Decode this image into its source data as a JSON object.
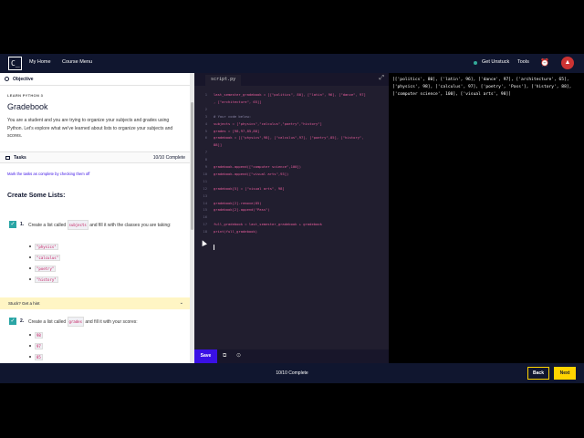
{
  "nav": {
    "logo": "C_",
    "my_home": "My Home",
    "course_menu": "Course Menu",
    "get_unstuck": "Get Unstuck",
    "tools": "Tools"
  },
  "objective": {
    "header": "Objective",
    "lesson_label": "LEARN PYTHON 3",
    "title": "Gradebook",
    "description": "You are a student and you are trying to organize your subjects and grades using Python. Let's explore what we've learned about lists to organize your subjects and scores."
  },
  "tasks": {
    "header": "Tasks",
    "count": "10/10 Complete",
    "mark_link": "Mark the tasks as complete by checking them off",
    "section_title": "Create Some Lists:",
    "task1": {
      "number": "1.",
      "text_before": "Create a list called",
      "code": "subjects",
      "text_after": "and fill it with the classes you are taking:",
      "items": [
        "\"physics\"",
        "\"calculus\"",
        "\"poetry\"",
        "\"history\""
      ]
    },
    "hint": "Stuck? Get a hint",
    "task2": {
      "number": "2.",
      "text_before": "Create a list called",
      "code": "grades",
      "text_after": "and fill it with your scores:",
      "items": [
        "98",
        "97",
        "85"
      ]
    }
  },
  "editor": {
    "filename": "script.py",
    "line_numbers": [
      "1",
      "2",
      "3",
      "4",
      "5",
      "6",
      "7",
      "8",
      "9",
      "10",
      "11",
      "12",
      "13",
      "14",
      "15",
      "16",
      "17",
      "18",
      "19"
    ],
    "lines": [
      "last_semester_gradebook = [[\"politics\", 80], [\"latin\", 96], [\"dance\", 97]",
      ", [\"architecture\", 65]]",
      "",
      "# Your code below:",
      "subjects = [\"physics\",\"calculus\",\"poetry\",\"history\"]",
      "grades = [98,97,85,88]",
      "gradebook = [[\"physics\",98], [\"calculus\",97], [\"poetry\",85], [\"history\",",
      "88]]",
      "",
      "",
      "gradebook.append([\"computer science\",100])",
      "gradebook.append([\"visual arts\",93])",
      "",
      "gradebook[5] = [\"visual arts\", 98]",
      "",
      "gradebook[2].remove(85)",
      "gradebook[2].append(\"Pass\")",
      "",
      "full_gradebook = last_semester_gradebook + gradebook",
      "print(full_gradebook)"
    ],
    "save": "Save"
  },
  "output": {
    "text": "[['politics', 80], ['latin', 96], ['dance', 97], ['architecture', 65], ['physics', 98], ['calculus', 97], ['poetry', 'Pass'], ['history', 88], ['computer science', 100], ['visual arts', 98]]"
  },
  "footer": {
    "complete": "10/10 Complete",
    "back": "Back",
    "next": "Next"
  },
  "colors": {
    "nav_bg": "#10162f",
    "editor_bg": "#211e2f",
    "accent": "#3a10e5",
    "yellow": "#ffd300",
    "check": "#2aa5a5"
  }
}
